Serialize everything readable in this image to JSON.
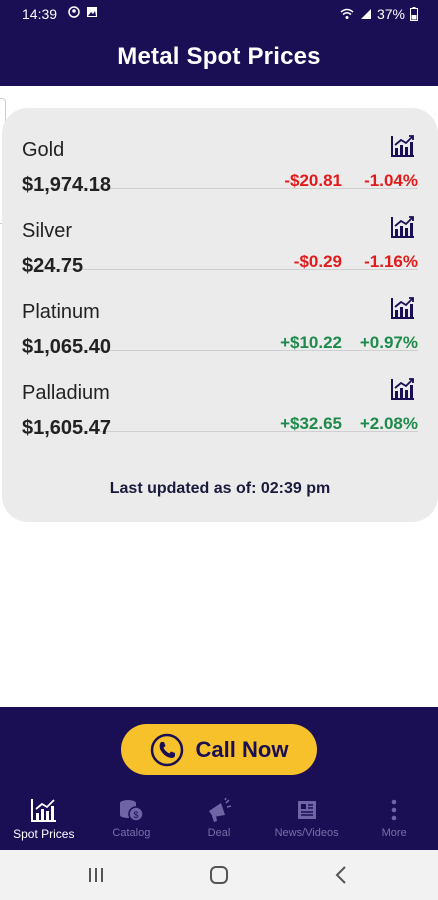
{
  "status": {
    "time": "14:39",
    "battery": "37%"
  },
  "header": {
    "title": "Metal Spot Prices"
  },
  "metals": [
    {
      "name": "Gold",
      "price": "$1,974.18",
      "change": "-$20.81",
      "change_pct": "-1.04%",
      "trend": "down"
    },
    {
      "name": "Silver",
      "price": "$24.75",
      "change": "-$0.29",
      "change_pct": "-1.16%",
      "trend": "down"
    },
    {
      "name": "Platinum",
      "price": "$1,065.40",
      "change": "+$10.22",
      "change_pct": "+0.97%",
      "trend": "up"
    },
    {
      "name": "Palladium",
      "price": "$1,605.47",
      "change": "+$32.65",
      "change_pct": "+2.08%",
      "trend": "up"
    }
  ],
  "updated": {
    "text": "Last updated as of:  02:39 pm"
  },
  "call": {
    "label": "Call Now"
  },
  "nav": {
    "spot": "Spot Prices",
    "catalog": "Catalog",
    "deal": "Deal",
    "news": "News/Videos",
    "more": "More"
  },
  "colors": {
    "primary": "#1a0e55",
    "accent": "#f6c12a",
    "negative": "#e11b1b",
    "positive": "#1e8a4c"
  }
}
